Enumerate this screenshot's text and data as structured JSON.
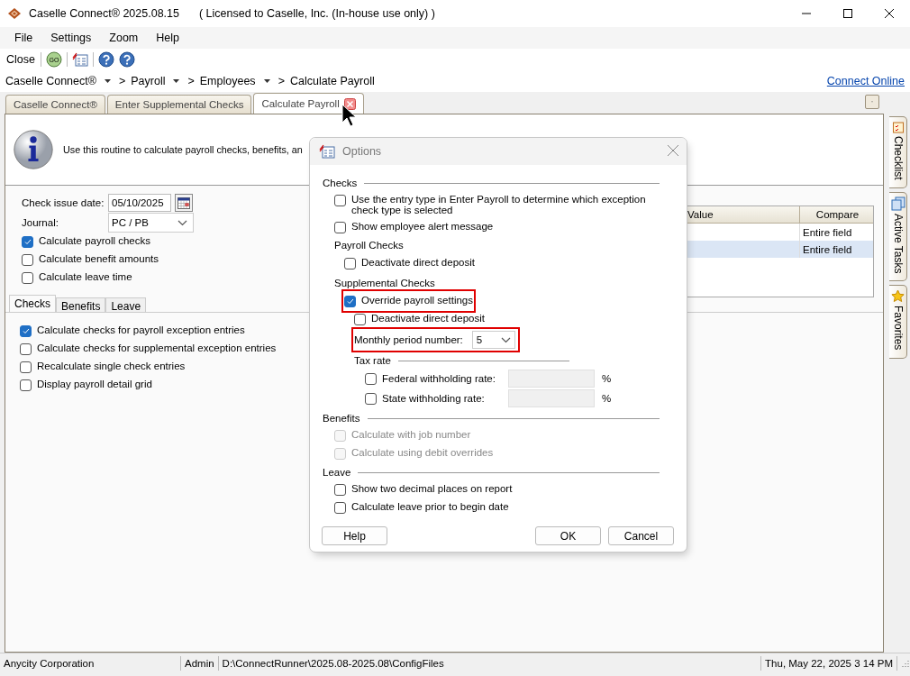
{
  "window": {
    "title": "Caselle Connect® 2025.08.15",
    "license": "( Licensed to Caselle, Inc. (In-house use only) )"
  },
  "menu": [
    "File",
    "Settings",
    "Zoom",
    "Help"
  ],
  "toolbar": {
    "close": "Close",
    "go_label": "GO"
  },
  "breadcrumb": [
    {
      "label": "Caselle Connect®",
      "dropdown": true
    },
    {
      "label": "Payroll",
      "dropdown": true
    },
    {
      "label": "Employees",
      "dropdown": true
    },
    {
      "label": "Calculate Payroll",
      "dropdown": false
    }
  ],
  "breadcrumb_separator": ">",
  "connect_link": "Connect Online",
  "doc_tabs": [
    {
      "label": "Caselle Connect®",
      "selected": false,
      "closable": false
    },
    {
      "label": "Enter Supplemental Checks",
      "selected": false,
      "closable": false
    },
    {
      "label": "Calculate Payroll",
      "selected": true,
      "closable": true
    }
  ],
  "side_tabs": [
    {
      "label": "Checklist",
      "kind": "checklist"
    },
    {
      "label": "Active Tasks",
      "kind": "tasks"
    },
    {
      "label": "Favorites",
      "kind": "favorites"
    }
  ],
  "info_text": "Use this routine to calculate payroll checks, benefits, an",
  "form": {
    "date_label": "Check issue date:",
    "date": "05/10/2025",
    "journal_label": "Journal:",
    "journal": "PC / PB",
    "options": [
      {
        "label": "Calculate payroll checks",
        "checked": true
      },
      {
        "label": "Calculate benefit amounts",
        "checked": false
      },
      {
        "label": "Calculate leave time",
        "checked": false
      }
    ]
  },
  "grid": {
    "columns": [
      "Value",
      "Compare"
    ],
    "rows": [
      {
        "compare": "Entire field",
        "selected": false
      },
      {
        "compare": "Entire field",
        "selected": true
      }
    ]
  },
  "sub_tabs": [
    {
      "label": "Checks",
      "selected": true
    },
    {
      "label": "Benefits",
      "selected": false
    },
    {
      "label": "Leave",
      "selected": false
    }
  ],
  "sub_options": [
    {
      "label": "Calculate checks for payroll exception entries",
      "checked": true
    },
    {
      "label": "Calculate checks for supplemental exception entries",
      "checked": false
    },
    {
      "label": "Recalculate single check entries",
      "checked": false
    },
    {
      "label": "Display payroll detail grid",
      "checked": false
    }
  ],
  "dialog": {
    "title": "Options",
    "checks": {
      "heading": "Checks",
      "options": [
        {
          "label": "Use the entry type in Enter Payroll to determine which exception check type is selected",
          "checked": false,
          "disabled": false
        },
        {
          "label": "Show employee alert message",
          "checked": false,
          "disabled": false
        }
      ],
      "payroll": {
        "heading": "Payroll Checks",
        "options": [
          {
            "label": "Deactivate direct deposit",
            "checked": false,
            "disabled": false
          }
        ]
      },
      "supplemental": {
        "heading": "Supplemental Checks",
        "override": {
          "label": "Override payroll settings",
          "checked": true,
          "highlighted": true
        },
        "options": [
          {
            "label": "Deactivate direct deposit",
            "checked": false,
            "disabled": false
          }
        ],
        "period": {
          "label": "Monthly period number:",
          "value": "5",
          "highlighted": true
        },
        "tax_rate": {
          "heading": "Tax rate",
          "rates": [
            {
              "label": "Federal withholding rate:",
              "checked": false,
              "unit": "%"
            },
            {
              "label": "State withholding rate:",
              "checked": false,
              "unit": "%"
            }
          ]
        }
      }
    },
    "benefits": {
      "heading": "Benefits",
      "options": [
        {
          "label": "Calculate with job number",
          "checked": false,
          "disabled": true
        },
        {
          "label": "Calculate using debit overrides",
          "checked": false,
          "disabled": true
        }
      ]
    },
    "leave": {
      "heading": "Leave",
      "options": [
        {
          "label": "Show two decimal places on report",
          "checked": false,
          "disabled": false
        },
        {
          "label": "Calculate leave prior to begin date",
          "checked": false,
          "disabled": false
        }
      ]
    },
    "buttons": [
      "Help",
      "OK",
      "Cancel"
    ]
  },
  "status_bar": {
    "company": "Anycity Corporation",
    "user": "Admin",
    "path": "D:\\ConnectRunner\\2025.08-2025.08\\ConfigFiles",
    "datetime": "Thu, May 22, 2025 3 14 PM"
  }
}
